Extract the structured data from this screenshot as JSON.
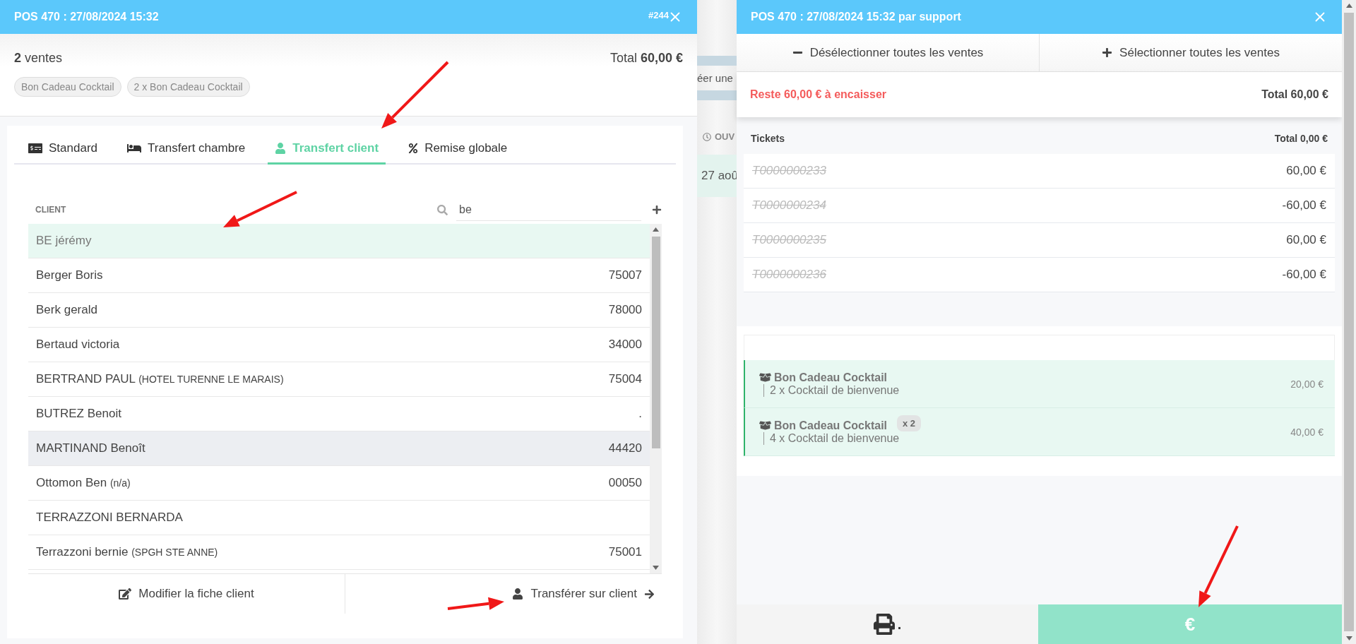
{
  "left_panel": {
    "title": "POS 470 : 27/08/2024 15:32",
    "ticket_number": "#244",
    "sales_count": "2",
    "sales_label": "ventes",
    "total_label": "Total",
    "total_value": "60,00 €",
    "tags": [
      "Bon Cadeau Cocktail",
      "2 x Bon Cadeau Cocktail"
    ],
    "tabs": [
      {
        "label": "Standard",
        "kind": "bill",
        "selected": false
      },
      {
        "label": "Transfert chambre",
        "kind": "bed",
        "selected": false
      },
      {
        "label": "Transfert client",
        "kind": "user",
        "selected": true
      },
      {
        "label": "Remise globale",
        "kind": "percent",
        "selected": false
      }
    ],
    "client_table": {
      "column": "CLIENT",
      "search": {
        "value": "be"
      },
      "rows": [
        {
          "name": "BE jérémy",
          "selected": true,
          "hovered": false
        },
        {
          "name": "Berger Boris",
          "code": "75007",
          "selected": false,
          "hovered": false
        },
        {
          "name": "Berk gerald",
          "code": "78000",
          "selected": false,
          "hovered": false
        },
        {
          "name": "Bertaud victoria",
          "code": "34000",
          "selected": false,
          "hovered": false
        },
        {
          "name": "BERTRAND PAUL",
          "detail": "(HOTEL TURENNE LE MARAIS)",
          "code": "75004",
          "selected": false,
          "hovered": false
        },
        {
          "name": "BUTREZ Benoit",
          "code": ".",
          "selected": false,
          "hovered": false
        },
        {
          "name": "MARTINAND Benoît",
          "code": "44420",
          "selected": false,
          "hovered": true
        },
        {
          "name": "Ottomon Ben",
          "detail": "(n/a)",
          "code": "00050",
          "selected": false,
          "hovered": false
        },
        {
          "name": "TERRAZZONI BERNARDA",
          "selected": false,
          "hovered": false
        },
        {
          "name": "Terrazzoni bernie",
          "detail": "(SPGH STE ANNE)",
          "code": "75001",
          "selected": false,
          "hovered": false
        }
      ]
    },
    "buttons": [
      {
        "label": "Modifier la fiche client",
        "kind": "edit"
      },
      {
        "label": "Transférer sur client",
        "kind": "transfer"
      }
    ]
  },
  "background_page": {
    "button_fragment": "éer une",
    "column_fragment": "OUV",
    "cell_fragment": "27 aoû"
  },
  "right_panel": {
    "title": "POS 470 : 27/08/2024 15:32 par support",
    "select_buttons": [
      {
        "label": "Désélectionner toutes les ventes",
        "kind": "minus"
      },
      {
        "label": "Sélectionner toutes les ventes",
        "kind": "plus"
      }
    ],
    "remaining": "Reste 60,00 € à encaisser",
    "total": "Total 60,00 €",
    "tickets_label": "Tickets",
    "tickets_total": "Total 0,00 €",
    "tickets": [
      {
        "id": "T0000000233",
        "amount": "60,00 €",
        "cancelled": true
      },
      {
        "id": "T0000000234",
        "amount": "-60,00 €",
        "cancelled": true
      },
      {
        "id": "T0000000235",
        "amount": "60,00 €",
        "cancelled": true
      },
      {
        "id": "T0000000236",
        "amount": "-60,00 €",
        "cancelled": true
      }
    ],
    "items": [
      {
        "name": "Bon Cadeau Cocktail",
        "detail": "2 x Cocktail de bienvenue",
        "price": "20,00 €"
      },
      {
        "name": "Bon Cadeau Cocktail",
        "quantity": "x 2",
        "detail": "4 x Cocktail de bienvenue",
        "price": "40,00 €"
      }
    ],
    "print_label": ".",
    "pay_label": "€"
  }
}
